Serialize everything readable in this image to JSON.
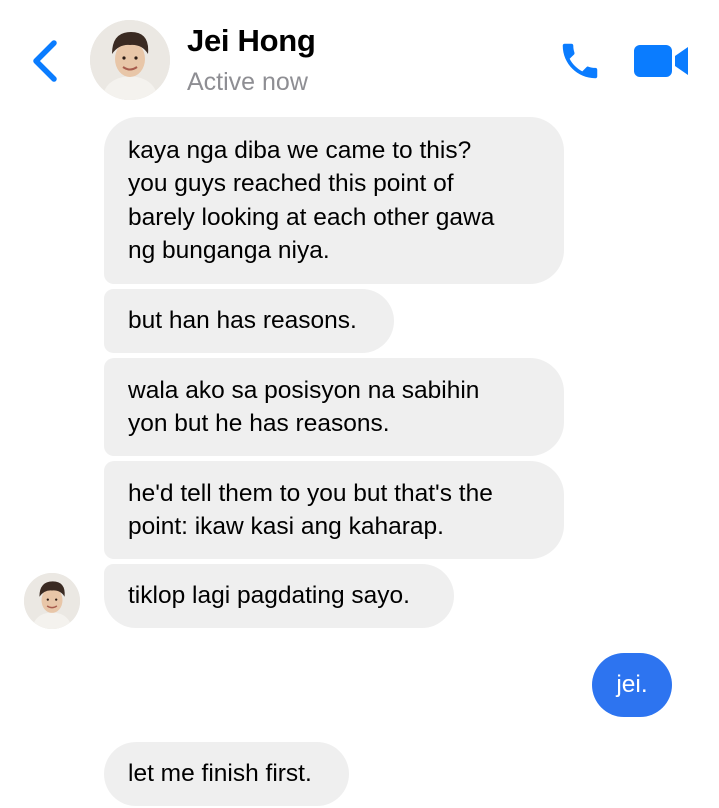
{
  "header": {
    "name": "Jei Hong",
    "status": "Active now",
    "back_icon": "chevron-left-icon",
    "phone_icon": "phone-icon",
    "video_icon": "video-camera-icon",
    "accent": "#0a7cff"
  },
  "messages": [
    {
      "sender": "other",
      "lines": [
        "kaya nga diba we came to this?",
        "you guys reached this point of",
        "barely looking at each other gawa",
        "ng bunganga niya."
      ]
    },
    {
      "sender": "other",
      "lines": [
        "but han has reasons."
      ]
    },
    {
      "sender": "other",
      "lines": [
        "wala ako sa posisyon na sabihin",
        "yon but he has reasons."
      ]
    },
    {
      "sender": "other",
      "lines": [
        "he'd tell them to you but that's the",
        "point: ikaw kasi ang kaharap."
      ]
    },
    {
      "sender": "other",
      "lines": [
        "tiklop lagi pagdating sayo."
      ]
    },
    {
      "sender": "me",
      "lines": [
        "jei."
      ]
    },
    {
      "sender": "other",
      "lines": [
        "let me finish first."
      ]
    }
  ],
  "colors": {
    "received_bubble": "#efefef",
    "sent_bubble": "#2d74f0",
    "status_text": "#8e8e93"
  }
}
